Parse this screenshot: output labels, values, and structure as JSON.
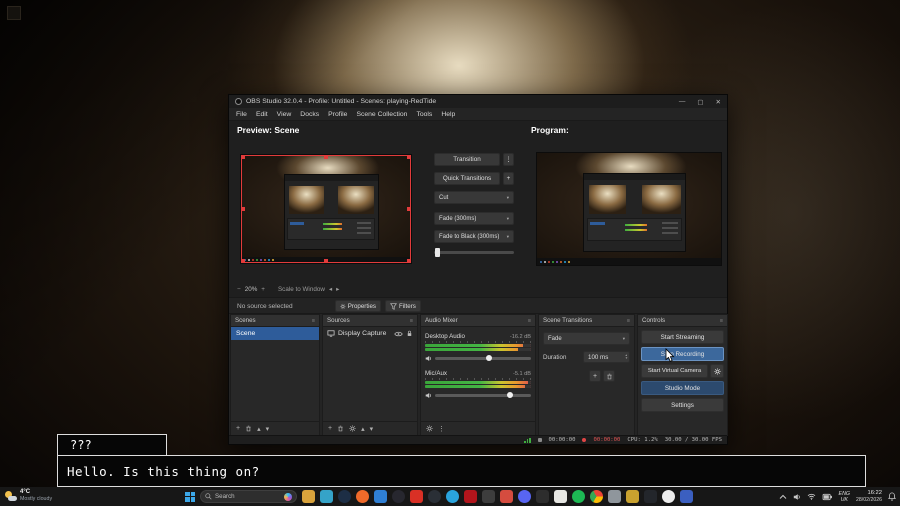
{
  "icons": {
    "minimize": "—",
    "maximize": "▢",
    "close": "✕",
    "kebab": "⋮",
    "plus": "+",
    "minus": "−",
    "up": "▴",
    "down": "▾",
    "left": "◂",
    "right": "▸",
    "menu": "≡"
  },
  "obs": {
    "title": "OBS Studio 32.0.4 - Profile: Untitled - Scenes: playing-RedTide",
    "menu": [
      "File",
      "Edit",
      "View",
      "Docks",
      "Profile",
      "Scene Collection",
      "Tools",
      "Help"
    ],
    "studio": {
      "preview_label": "Preview: Scene",
      "program_label": "Program:",
      "transition_button": "Transition",
      "quick_transitions_button": "Quick Transitions",
      "transition_options": [
        "Cut",
        "Fade (300ms)",
        "Fade to Black (300ms)"
      ]
    },
    "preview_toolbar": {
      "zoom": "20%",
      "scale": "Scale to Window"
    },
    "source_toolbar": {
      "status": "No source selected",
      "properties": "Properties",
      "filters": "Filters"
    },
    "docks": {
      "scenes": {
        "title": "Scenes",
        "items": [
          "Scene"
        ]
      },
      "sources": {
        "title": "Sources",
        "items": [
          "Display Capture"
        ]
      },
      "audio_mixer": {
        "title": "Audio Mixer",
        "channels": [
          {
            "name": "Desktop Audio",
            "level": "-16.2 dB",
            "meter_pct": 92,
            "fader_pct": 56
          },
          {
            "name": "Mic/Aux",
            "level": "-5.1 dB",
            "meter_pct": 97,
            "fader_pct": 78
          }
        ]
      },
      "scene_transitions": {
        "title": "Scene Transitions",
        "selected": "Fade",
        "duration_label": "Duration",
        "duration_value": "100 ms"
      },
      "controls": {
        "title": "Controls",
        "buttons": [
          "Start Streaming",
          "Stop Recording",
          "Start Virtual Camera",
          "Studio Mode",
          "Settings"
        ]
      }
    },
    "status_bar": {
      "stream_time": "00:00:00",
      "rec_time": "00:00:00",
      "cpu": "CPU: 1.2%",
      "fps": "30.00 / 30.00 FPS"
    },
    "accent_blue": "#2e5c9a",
    "rec_red": "#e04545"
  },
  "desktop": {
    "dialog": {
      "speaker": "???",
      "text": "Hello. Is this thing on?"
    }
  },
  "taskbar": {
    "weather": {
      "temp": "4°C",
      "condition": "Mostly cloudy"
    },
    "search": "Search",
    "language": {
      "line1": "ENG",
      "line2": "UK"
    },
    "clock": {
      "time": "16:22",
      "date": "28/02/2026"
    },
    "icons": [
      {
        "name": "file-explorer",
        "color": "#d9a33c"
      },
      {
        "name": "edge",
        "color": "#35a3c8"
      },
      {
        "name": "steam",
        "color": "#1d2e45"
      },
      {
        "name": "firefox",
        "color": "#f06a2a"
      },
      {
        "name": "vscode",
        "color": "#2f7fd4"
      },
      {
        "name": "obs",
        "color": "#27272f"
      },
      {
        "name": "youtube",
        "color": "#d93025"
      },
      {
        "name": "github",
        "color": "#2a2f36"
      },
      {
        "name": "telegram",
        "color": "#2aa4dd"
      },
      {
        "name": "netflix",
        "color": "#b2151c"
      },
      {
        "name": "blender",
        "color": "#3d3d3d"
      },
      {
        "name": "gmail",
        "color": "#d54c3f"
      },
      {
        "name": "discord",
        "color": "#5865f2"
      },
      {
        "name": "terminal",
        "color": "#2d2d2d"
      },
      {
        "name": "notion",
        "color": "#e6e6e2"
      },
      {
        "name": "spotify",
        "color": "#1db954"
      },
      {
        "name": "chrome",
        "color": "conic-gradient(from -30deg,#ea4335 0 120deg,#fbbc05 0 240deg,#34a853 0 360deg)"
      },
      {
        "name": "settings",
        "color": "#8f969c"
      },
      {
        "name": "epic-games",
        "color": "#c9a22f"
      },
      {
        "name": "dark-app",
        "color": "#23262b"
      },
      {
        "name": "ubisoft-connect",
        "color": "#ededed"
      },
      {
        "name": "protonvpn",
        "color": "#3b5fc0"
      }
    ]
  }
}
